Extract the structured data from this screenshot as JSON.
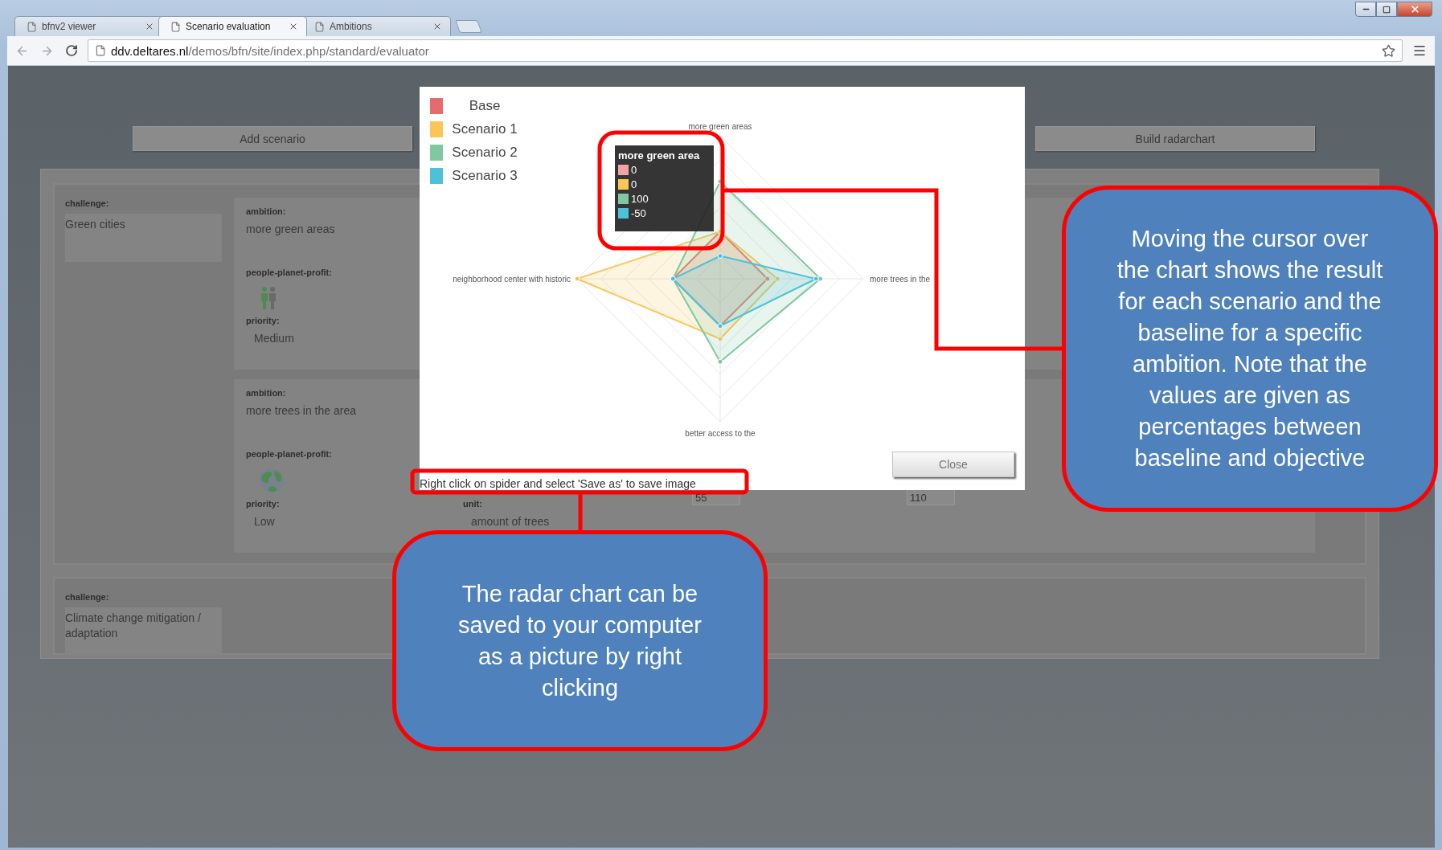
{
  "browser": {
    "tabs": [
      {
        "title": "bfnv2 viewer",
        "selected": false
      },
      {
        "title": "Scenario evaluation",
        "selected": true
      },
      {
        "title": "Ambitions",
        "selected": false
      }
    ],
    "address": {
      "host": "ddv.deltares.nl",
      "path": "/demos/bfn/site/index.php/standard/evaluator"
    }
  },
  "page": {
    "buttons": [
      "Add scenario",
      "Build radarchart"
    ],
    "challenges": [
      {
        "label": "challenge:",
        "value": "Green cities",
        "ambitions": [
          {
            "ambition_label": "ambition:",
            "ambition": "more green areas",
            "ppp_label": "people-planet-profit:",
            "kind": "people",
            "priority_label": "priority:",
            "priority": "Medium"
          },
          {
            "ambition_label": "ambition:",
            "ambition": "more trees in the area",
            "ppp_label": "people-planet-profit:",
            "kind": "planet",
            "priority_label": "priority:",
            "priority": "Low",
            "unit_label": "unit:",
            "unit": "amount of trees",
            "inputs": [
              "55",
              "110"
            ]
          }
        ]
      },
      {
        "label": "challenge:",
        "value": "Climate change mitigation / adaptation"
      }
    ]
  },
  "dialog": {
    "legend": [
      {
        "label": "Base",
        "color": "#e46c6c"
      },
      {
        "label": "Scenario 1",
        "color": "#fcc55a"
      },
      {
        "label": "Scenario 2",
        "color": "#7fc8a0"
      },
      {
        "label": "Scenario 3",
        "color": "#4dc0da"
      }
    ],
    "axes": [
      "more green areas",
      "more trees in the",
      "better access to the",
      "neighborhood center with historic"
    ],
    "tooltip": {
      "title": "more green area",
      "items": [
        {
          "value": "0",
          "color": "#f2a3a3"
        },
        {
          "value": "0",
          "color": "#fcc55a"
        },
        {
          "value": "100",
          "color": "#7fc8a0"
        },
        {
          "value": "-50",
          "color": "#4dc0da"
        }
      ]
    },
    "close_button": "Close",
    "save_hint": "Right click on spider and select 'Save as' to save image"
  },
  "callouts": [
    {
      "text": "Moving the cursor over the chart shows the result for each scenario and the baseline for a specific ambition. Note that the values are given as percentages between baseline and objective"
    },
    {
      "text": "The radar chart can be saved to your computer as a picture by right clicking"
    }
  ]
}
